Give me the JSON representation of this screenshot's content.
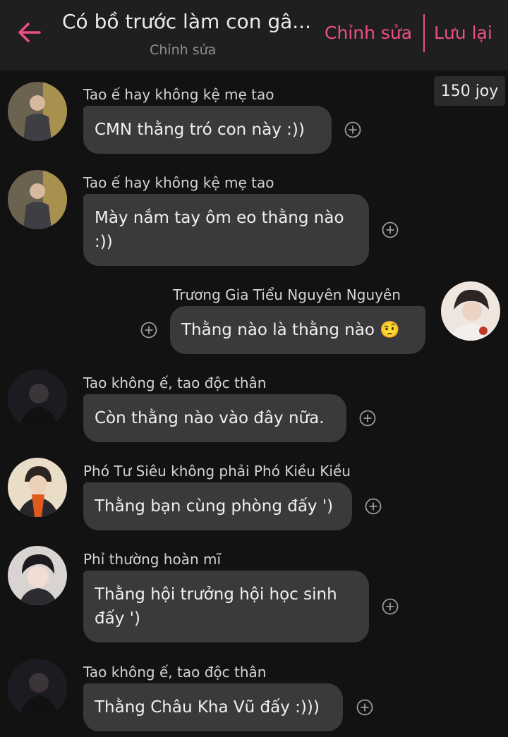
{
  "header": {
    "title": "Có bồ trước làm con gâ...",
    "subtitle": "Chỉnh sửa",
    "edit_label": "Chỉnh sửa",
    "save_label": "Lưu lại",
    "accent": "#ee4e88"
  },
  "joy_badge": "150 joy",
  "messages": [
    {
      "sender": "Tao ế hay không kệ mẹ tao",
      "text": "CMN thằng tró con này :))",
      "side": "left"
    },
    {
      "sender": "Tao ế hay không kệ mẹ tao",
      "text": "Mày nắm tay ôm eo thằng nào :))",
      "side": "left"
    },
    {
      "sender": "Trương Gia Tiểu Nguyên Nguyên",
      "text": "Thằng nào là thằng nào 🤨",
      "side": "right"
    },
    {
      "sender": "Tao không ế, tao độc thân",
      "text": "Còn thằng nào vào đây nữa.",
      "side": "left"
    },
    {
      "sender": "Phó Tư Siêu không phải Phó Kiều Kiều",
      "text": "Thằng bạn cùng phòng đấy ')",
      "side": "left"
    },
    {
      "sender": "Phỉ thường hoàn mĩ",
      "text": "Thằng hội trưởng hội học sinh đấy ')",
      "side": "left"
    },
    {
      "sender": "Tao không ế, tao độc thân",
      "text": "Thằng Châu Kha Vũ đấy :)))",
      "side": "left"
    }
  ],
  "icons": {
    "back": "arrow-left-icon",
    "reaction": "add-circle-icon"
  },
  "colors": {
    "background": "#121212",
    "header": "#1f1f1f",
    "bubble": "#3a3a3c"
  }
}
